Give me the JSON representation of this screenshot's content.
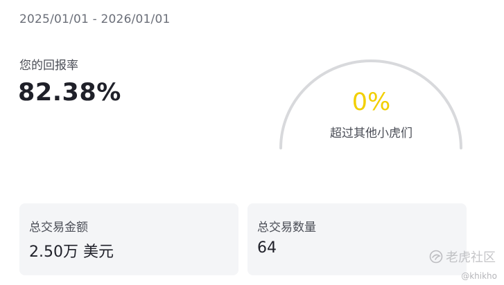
{
  "header": {
    "date_range": "2025/01/01 - 2026/01/01"
  },
  "returns": {
    "label": "您的回报率",
    "value": "82.38%"
  },
  "gauge": {
    "percent": "0%",
    "percent_value": 0,
    "caption": "超过其他小虎们",
    "accent_color": "#f2cf00",
    "track_color": "#d8d9dc"
  },
  "cards": {
    "total_amount": {
      "label": "总交易金额",
      "value": "2.50万 美元"
    },
    "total_count": {
      "label": "总交易数量",
      "value": "64"
    }
  },
  "watermark": {
    "text": "老虎社区",
    "handle": "@khikho",
    "icon": "tiger-community-icon"
  }
}
